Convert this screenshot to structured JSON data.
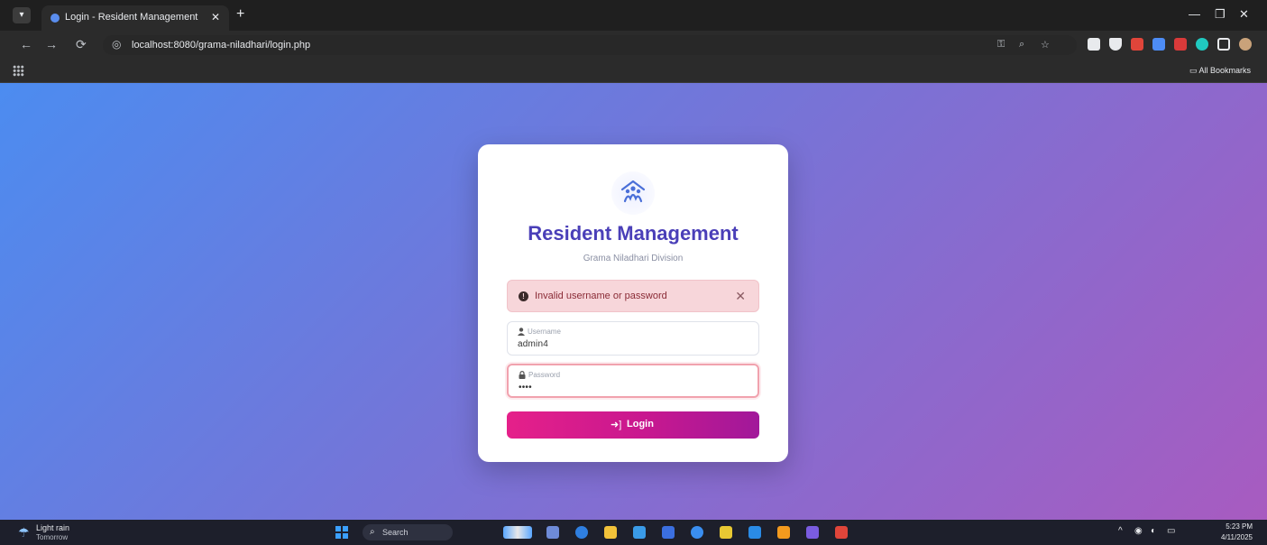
{
  "browser": {
    "tab_menu_icon": "chevron-down",
    "tab_title": "Login - Resident Management",
    "tab_close": "✕",
    "new_tab": "+",
    "window": {
      "minimize": "—",
      "restore": "❐",
      "close": "✕"
    },
    "nav": {
      "back": "←",
      "forward": "→",
      "reload": "⟳"
    },
    "url": "localhost:8080/grama-niladhari/login.php",
    "bookmarks_label": "All Bookmarks"
  },
  "login": {
    "title": "Resident Management",
    "subtitle": "Grama Niladhari Division",
    "alert_message": "Invalid username or password",
    "alert_close": "✕",
    "username_label": "Username",
    "username_value": "admin4",
    "password_label": "Password",
    "password_value": "••••",
    "button_label": "Login",
    "colors": {
      "title": "#4a3fb8",
      "button_start": "#e5208a",
      "button_end": "#a1189a",
      "alert_bg": "#f7d6da"
    }
  },
  "taskbar": {
    "weather_title": "Light rain",
    "weather_sub": "Tomorrow",
    "search_placeholder": "Search",
    "time": "5:23 PM",
    "date": "4/11/2025"
  }
}
